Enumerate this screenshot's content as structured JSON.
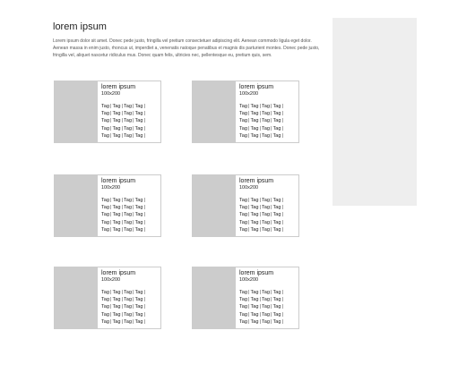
{
  "main": {
    "title": "lorem ipsum",
    "intro": "Lorem ipsum dolor sit amet. Donec pede justo, fringilla vel pretium consectetuer adipiscing elit. Aenean commodo ligula eget dolor. Aenean massa in enim justo, rhoncus ut, imperdiet a, venenatis natoque penatibus et magnis dis parturient montes. Donec pede justo, fringilla vel, aliquet nascetur ridiculus mus. Donec quam felis, ultricies nec, pellentesque eu, pretium quis, sem."
  },
  "cards": [
    {
      "title": "lorem ipsum",
      "size": "100x200",
      "tags": [
        "Tag",
        "Tag",
        "Tag",
        "Tag"
      ]
    },
    {
      "title": "lorem ipsum",
      "size": "100x200",
      "tags": [
        "Tag",
        "Tag",
        "Tag",
        "Tag"
      ]
    },
    {
      "title": "lorem ipsum",
      "size": "100x200",
      "tags": [
        "Tag",
        "Tag",
        "Tag",
        "Tag"
      ]
    },
    {
      "title": "lorem ipsum",
      "size": "100x200",
      "tags": [
        "Tag",
        "Tag",
        "Tag",
        "Tag"
      ]
    },
    {
      "title": "lorem ipsum",
      "size": "100x200",
      "tags": [
        "Tag",
        "Tag",
        "Tag",
        "Tag"
      ]
    },
    {
      "title": "lorem ipsum",
      "size": "100x200",
      "tags": [
        "Tag",
        "Tag",
        "Tag",
        "Tag"
      ]
    }
  ],
  "colors": {
    "thumb": "#cccccc",
    "sidebar": "#eeeeee",
    "border": "#cccccc"
  }
}
